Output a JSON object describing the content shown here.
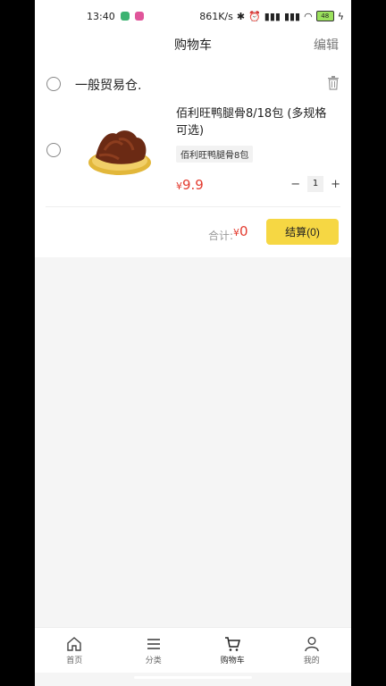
{
  "status": {
    "time": "13:40",
    "net": "861K/s",
    "battery": "48"
  },
  "nav": {
    "title": "购物车",
    "edit": "编辑"
  },
  "store": {
    "name": "一般贸易仓."
  },
  "item": {
    "title": "佰利旺鸭腿骨8/18包 (多规格可选)",
    "spec": "佰利旺鸭腿骨8包",
    "currency": "¥",
    "price": "9.9",
    "qty": "1",
    "minus": "−",
    "plus": "+"
  },
  "summary": {
    "total_label": "合计:",
    "currency": "¥",
    "total": "0",
    "checkout": "结算(0)"
  },
  "tabs": [
    {
      "label": "首页",
      "icon": "home-icon"
    },
    {
      "label": "分类",
      "icon": "menu-icon"
    },
    {
      "label": "购物车",
      "icon": "cart-icon"
    },
    {
      "label": "我的",
      "icon": "user-icon"
    }
  ],
  "colors": {
    "accent": "#f6d743",
    "price": "#e33b2f"
  }
}
